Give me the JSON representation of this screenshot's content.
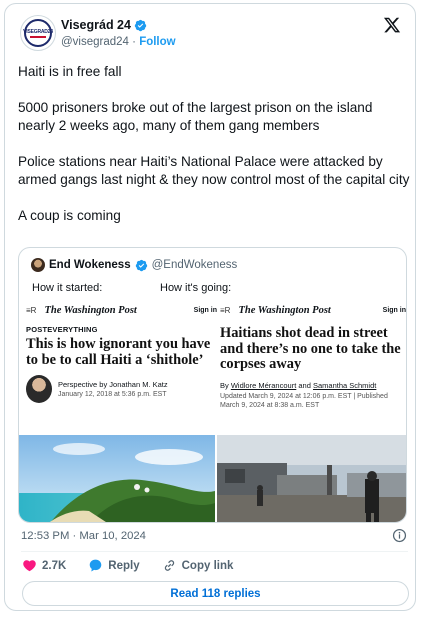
{
  "account": {
    "display_name": "Visegrád 24",
    "handle": "@visegrad24",
    "separator": "·",
    "follow_label": "Follow",
    "avatar_text": "VISEGRAD24"
  },
  "tweet": {
    "paragraphs": [
      "Haiti is in free fall",
      "5000 prisoners broke out of the largest prison on the island nearly 2 weeks ago, many of them gang members",
      "Police stations near Haiti’s National Palace were attacked by armed gangs last night & they now control most of the capital city",
      "A coup is coming"
    ],
    "timestamp": "12:53 PM · Mar 10, 2024"
  },
  "quote": {
    "display_name": "End Wokeness",
    "handle": "@EndWokeness",
    "caption_left": "How it started:",
    "caption_right": "How it's going:",
    "left_article": {
      "menu": "≡R",
      "brand": "The Washington Post",
      "signin": "Sign in",
      "kicker": "POSTEVERYTHING",
      "headline": "This is how ignorant you have to be to call Haiti a ‘shithole’",
      "byline": "Perspective by Jonathan M. Katz",
      "date": "January 12, 2018 at 5:36 p.m. EST"
    },
    "right_article": {
      "menu": "≡R",
      "brand": "The Washington Post",
      "signin": "Sign in",
      "headline": "Haitians shot dead in street and there’s no one to take the corpses away",
      "by_prefix": "By ",
      "author1": "Widlore Mérancourt",
      "and": " and ",
      "author2": "Samantha Schmidt",
      "updated": "Updated March 9, 2024 at 12:06 p.m. EST | Published March 9, 2024 at 8:38 a.m. EST"
    }
  },
  "actions": {
    "likes": "2.7K",
    "reply_label": "Reply",
    "copy_link_label": "Copy link",
    "read_replies_label": "Read 118 replies"
  },
  "colors": {
    "accent": "#1d9bf0",
    "like": "#f91880",
    "link": "#006fd6"
  }
}
